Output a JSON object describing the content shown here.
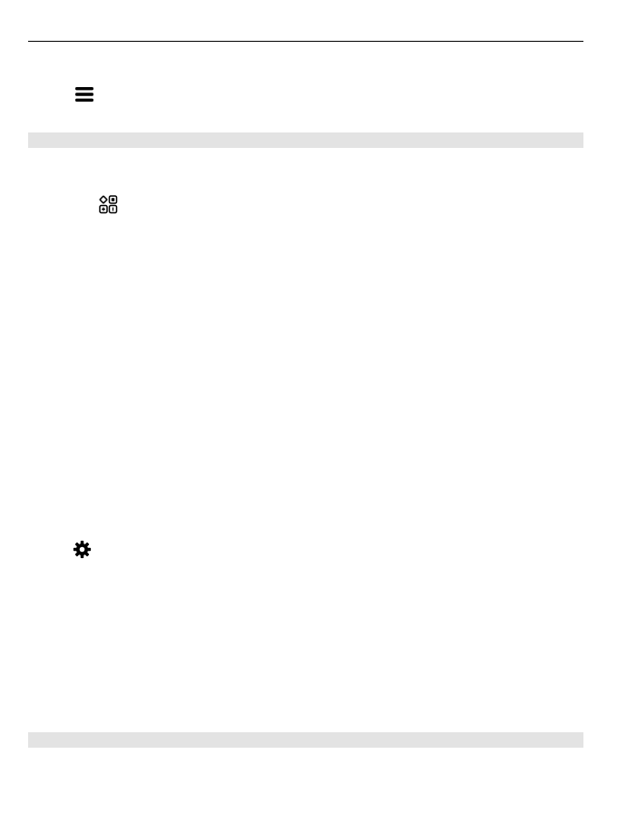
{
  "page": {
    "background": "#ffffff",
    "rule_color": "#000000",
    "band_color": "#e3e3e3"
  },
  "icons": {
    "menu": "menu-icon",
    "apps": "apps-grid-icon",
    "settings": "gear-icon"
  }
}
